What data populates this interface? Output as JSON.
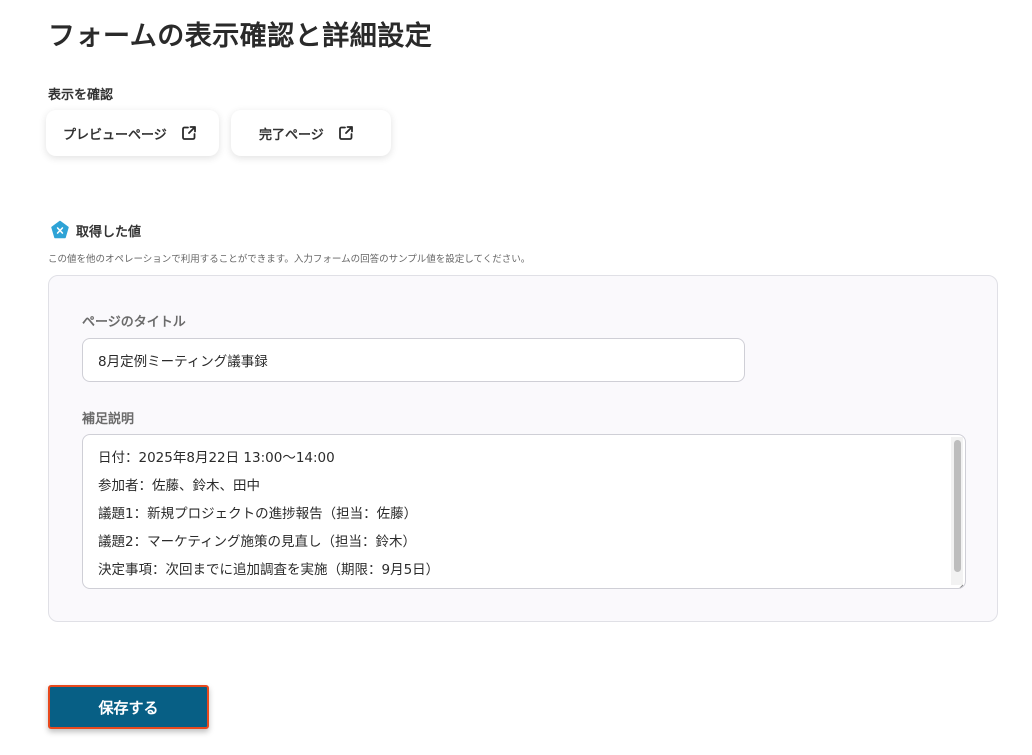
{
  "header": {
    "title": "フォームの表示確認と詳細設定"
  },
  "preview_section": {
    "label": "表示を確認",
    "preview_button": "プレビューページ",
    "complete_button": "完了ページ"
  },
  "values_section": {
    "title": "取得した値",
    "description": "この値を他のオペレーションで利用することができます。入力フォームの回答のサンプル値を設定してください。",
    "page_title_label": "ページのタイトル",
    "page_title_value": "8月定例ミーティング議事録",
    "note_label": "補足説明",
    "note_lines": [
      "日付：2025年8月22日 13:00〜14:00",
      "参加者：佐藤、鈴木、田中",
      "議題1：新規プロジェクトの進捗報告（担当：佐藤）",
      "議題2：マーケティング施策の見直し（担当：鈴木）",
      "決定事項：次回までに追加調査を実施（期限：9月5日）"
    ]
  },
  "footer": {
    "save_label": "保存する"
  },
  "colors": {
    "accent": "#075f85",
    "highlight_border": "#e8491d",
    "badge": "#2ea3d6"
  }
}
